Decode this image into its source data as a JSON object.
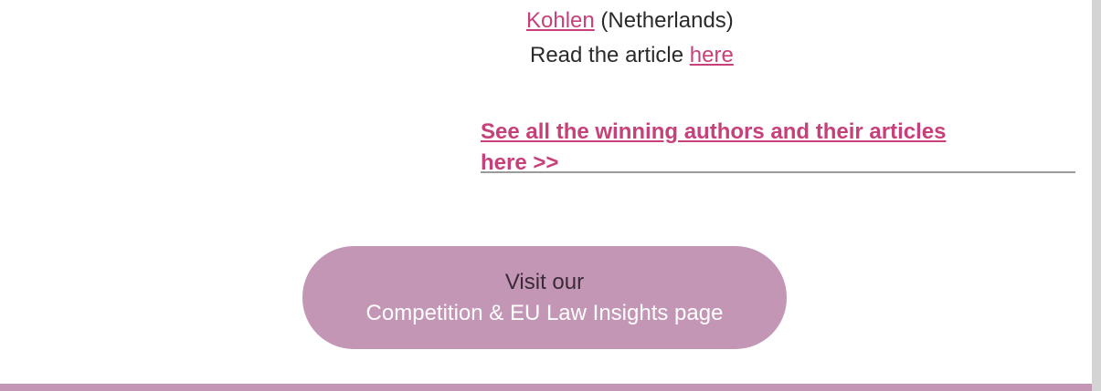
{
  "article": {
    "partial_link": "Kohlen",
    "country": " (Netherlands)",
    "read_prefix": "Read the article ",
    "read_link": "here"
  },
  "cta": {
    "label": "See all the winning authors and their articles here >>"
  },
  "visit_button": {
    "line1": "Visit our",
    "line2": "Competition & EU Law Insights page"
  },
  "colors": {
    "link": "#c8407a",
    "button_bg": "#c496b6",
    "divider": "#9a9a9a",
    "footer_band": "#c496b6"
  }
}
